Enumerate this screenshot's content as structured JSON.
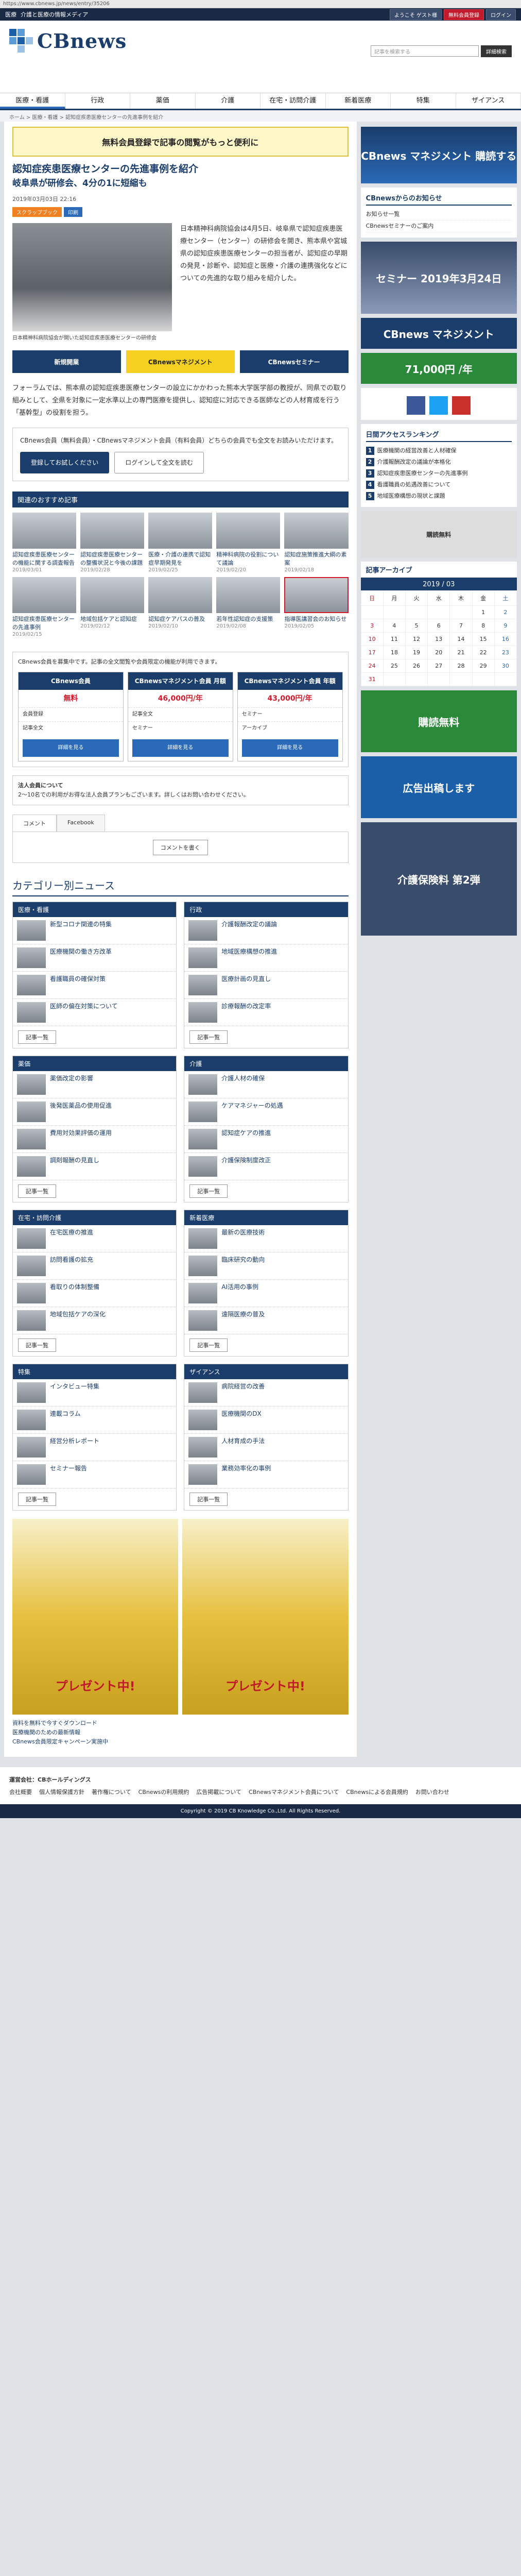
{
  "chrome": {
    "url": "https://www.cbnews.jp/news/entry/35206"
  },
  "topbar": {
    "site": "医療",
    "tagline": "介護と医療の情報メディア",
    "links": [
      "ようこそ ゲスト様",
      "無料会員登録",
      "ログイン"
    ]
  },
  "logo": {
    "text": "CBnews"
  },
  "search": {
    "placeholder": "記事を検索する",
    "button": "詳細検索"
  },
  "nav": [
    "医療・看護",
    "行政",
    "薬価",
    "介護",
    "在宅・訪問介護",
    "新着医療",
    "特集",
    "ザイアンス"
  ],
  "breadcrumb": "ホーム > 医療・看護 > 認知症疾患医療センターの先進事例を紹介",
  "banner_top": "無料会員登録で記事の閲覧がもっと便利に",
  "article": {
    "title": "認知症疾患医療センターの先進事例を紹介",
    "subtitle": "岐阜県が研修会、4分の1に短縮も",
    "date": "2019年03月03日 22:16",
    "tags": [
      "スクラップブック",
      "印刷"
    ],
    "photo_caption": "日本精神科病院協会が開いた認知症疾患医療センターの研修会",
    "body1": "日本精神科病院協会は4月5日、岐阜県で認知症疾患医療センター（センター）の研修会を開き、熊本県や宮城県の認知症疾患医療センターの担当者が、認知症の早期の発見・診断や、認知症と医療・介護の連携強化などについての先進的な取り組みを紹介した。",
    "body2": "フォーラムでは、熊本県の認知症疾患医療センターの設立にかかわった熊本大学医学部の教授が、同県での取り組みとして、全県を対象に一定水準以上の専門医療を提供し、認知症に対応できる医師などの人材育成を行う「基幹型」の役割を担う。"
  },
  "promo": [
    "新規開業",
    "CBnewsマネジメント",
    "CBnewsセミナー"
  ],
  "member": {
    "text": "CBnews会員（無料会員）・CBnewsマネジメント会員（有料会員）どちらの会員でも全文をお読みいただけます。",
    "btn_register": "登録してお試しください",
    "btn_login": "ログインして全文を読む"
  },
  "recommend": {
    "title": "関連のおすすめ記事",
    "items": [
      {
        "title": "認知症疾患医療センターの機能に関する調査報告",
        "date": "2019/03/01"
      },
      {
        "title": "認知症疾患医療センターの整備状況と今後の課題",
        "date": "2019/02/28"
      },
      {
        "title": "医療・介護の連携で認知症早期発見を",
        "date": "2019/02/25"
      },
      {
        "title": "精神科病院の役割について議論",
        "date": "2019/02/20"
      },
      {
        "title": "認知症施策推進大綱の素案",
        "date": "2019/02/18"
      },
      {
        "title": "認知症疾患医療センターの先進事例",
        "date": "2019/02/15"
      },
      {
        "title": "地域包括ケアと認知症",
        "date": "2019/02/12"
      },
      {
        "title": "認知症ケアパスの普及",
        "date": "2019/02/10"
      },
      {
        "title": "若年性認知症の支援策",
        "date": "2019/02/08"
      },
      {
        "title": "指導医講習会のお知らせ",
        "date": "2019/02/05"
      }
    ]
  },
  "subs": {
    "text": "CBnews会員を募集中です。記事の全文閲覧や会員限定の機能が利用できます。",
    "plans": [
      {
        "name": "CBnews会員",
        "price": "無料",
        "btn": "詳細を見る"
      },
      {
        "name": "CBnewsマネジメント会員 月額",
        "price": "46,000円/年",
        "btn": "詳細を見る"
      },
      {
        "name": "CBnewsマネジメント会員 年額",
        "price": "43,000円/年",
        "btn": "詳細を見る"
      }
    ],
    "features": [
      "会員登録",
      "記事全文",
      "セミナー",
      "アーカイブ"
    ]
  },
  "note": {
    "title": "法人会員について",
    "text": "2～10名での利用がお得な法人会員プランもございます。詳しくはお問い合わせください。"
  },
  "comments": {
    "tabs": [
      "コメント",
      "Facebook"
    ],
    "button": "コメントを書く"
  },
  "categories": {
    "title": "カテゴリー別ニュース",
    "cols": [
      {
        "name": "医療・看護",
        "items": [
          "新型コロナ関連の特集",
          "医療機関の働き方改革",
          "看護職員の確保対策",
          "医師の偏在対策について"
        ]
      },
      {
        "name": "行政",
        "items": [
          "介護報酬改定の議論",
          "地域医療構想の推進",
          "医療計画の見直し",
          "診療報酬の改定率"
        ]
      },
      {
        "name": "薬価",
        "items": [
          "薬価改定の影響",
          "後発医薬品の使用促進",
          "費用対効果評価の運用",
          "調剤報酬の見直し"
        ]
      },
      {
        "name": "介護",
        "items": [
          "介護人材の確保",
          "ケアマネジャーの処遇",
          "認知症ケアの推進",
          "介護保険制度改正"
        ]
      },
      {
        "name": "在宅・訪問介護",
        "items": [
          "在宅医療の推進",
          "訪問看護の拡充",
          "看取りの体制整備",
          "地域包括ケアの深化"
        ]
      },
      {
        "name": "新着医療",
        "items": [
          "最新の医療技術",
          "臨床研究の動向",
          "AI活用の事例",
          "遠隔医療の普及"
        ]
      },
      {
        "name": "特集",
        "items": [
          "インタビュー特集",
          "連載コラム",
          "経営分析レポート",
          "セミナー報告"
        ]
      },
      {
        "name": "ザイアンス",
        "items": [
          "病院経営の改善",
          "医療機関のDX",
          "人材育成の手法",
          "業務効率化の事例"
        ]
      }
    ],
    "more": "記事一覧"
  },
  "ads_bottom": [
    "プレゼント中!",
    "プレゼント中!"
  ],
  "ad_links": [
    "資料を無料で今すぐダウンロード",
    "医療機関のための最新情報",
    "CBnews会員限定キャンペーン実施中"
  ],
  "right": {
    "ad_top": "CBnews マネジメント 購読する",
    "side_title": "CBnewsからのお知らせ",
    "side_items": [
      "お知らせ一覧",
      "CBnewsセミナーのご案内"
    ],
    "seminar_ad": "セミナー 2019年3月24日",
    "mgmt_ad": "CBnews マネジメント",
    "price_ad": "71,000円 /年",
    "rank_title": "日間アクセスランキング",
    "rank": [
      "医療機関の経営改善と人材確保",
      "介護報酬改定の議論が本格化",
      "認知症疾患医療センターの先進事例",
      "看護職員の処遇改善について",
      "地域医療構想の現状と課題"
    ],
    "archive_title": "記事アーカイブ",
    "cal_month": "2019 / 03",
    "days": [
      "日",
      "月",
      "火",
      "水",
      "木",
      "金",
      "土"
    ],
    "dates": [
      [
        "",
        "",
        "",
        "",
        "",
        "1",
        "2"
      ],
      [
        "3",
        "4",
        "5",
        "6",
        "7",
        "8",
        "9"
      ],
      [
        "10",
        "11",
        "12",
        "13",
        "14",
        "15",
        "16"
      ],
      [
        "17",
        "18",
        "19",
        "20",
        "21",
        "22",
        "23"
      ],
      [
        "24",
        "25",
        "26",
        "27",
        "28",
        "29",
        "30"
      ],
      [
        "31",
        "",
        "",
        "",
        "",
        "",
        ""
      ]
    ],
    "ads": [
      "購読無料",
      "広告出稿します",
      "介護保険料 第2弾"
    ]
  },
  "footer": {
    "company": "運営会社：CBホールディングス",
    "links": [
      "会社概要",
      "個人情報保護方針",
      "著作権について",
      "CBnewsの利用規約",
      "広告掲載について",
      "CBnewsマネジメント会員について",
      "CBnewsによる会員規約",
      "お問い合わせ"
    ],
    "copyright": "Copyright © 2019 CB Knowledge Co.,Ltd. All Rights Reserved."
  }
}
